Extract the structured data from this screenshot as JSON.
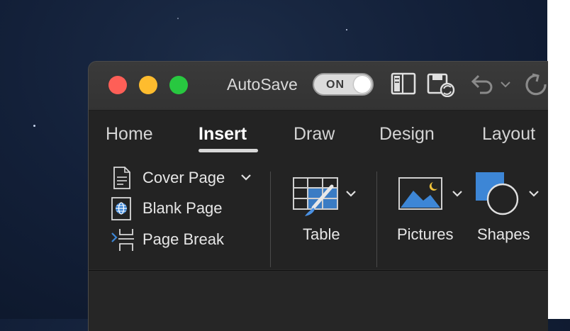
{
  "titlebar": {
    "autosave_label": "AutoSave",
    "autosave_toggle": "ON"
  },
  "tabs": [
    {
      "label": "Home",
      "active": false
    },
    {
      "label": "Insert",
      "active": true
    },
    {
      "label": "Draw",
      "active": false
    },
    {
      "label": "Design",
      "active": false
    },
    {
      "label": "Layout",
      "active": false
    }
  ],
  "pages_group": {
    "items": [
      {
        "label": "Cover Page",
        "icon": "cover-page-icon",
        "has_dropdown": true
      },
      {
        "label": "Blank Page",
        "icon": "blank-page-icon",
        "has_dropdown": false
      },
      {
        "label": "Page Break",
        "icon": "page-break-icon",
        "has_dropdown": false
      }
    ]
  },
  "table_group": {
    "label": "Table",
    "icon": "table-icon"
  },
  "illustrations": [
    {
      "label": "Pictures",
      "icon": "pictures-icon"
    },
    {
      "label": "Shapes",
      "icon": "shapes-icon"
    }
  ],
  "colors": {
    "accent_blue": "#3d86d6",
    "close": "#fe5f57",
    "minimize": "#febc2e",
    "maximize": "#28c840"
  }
}
